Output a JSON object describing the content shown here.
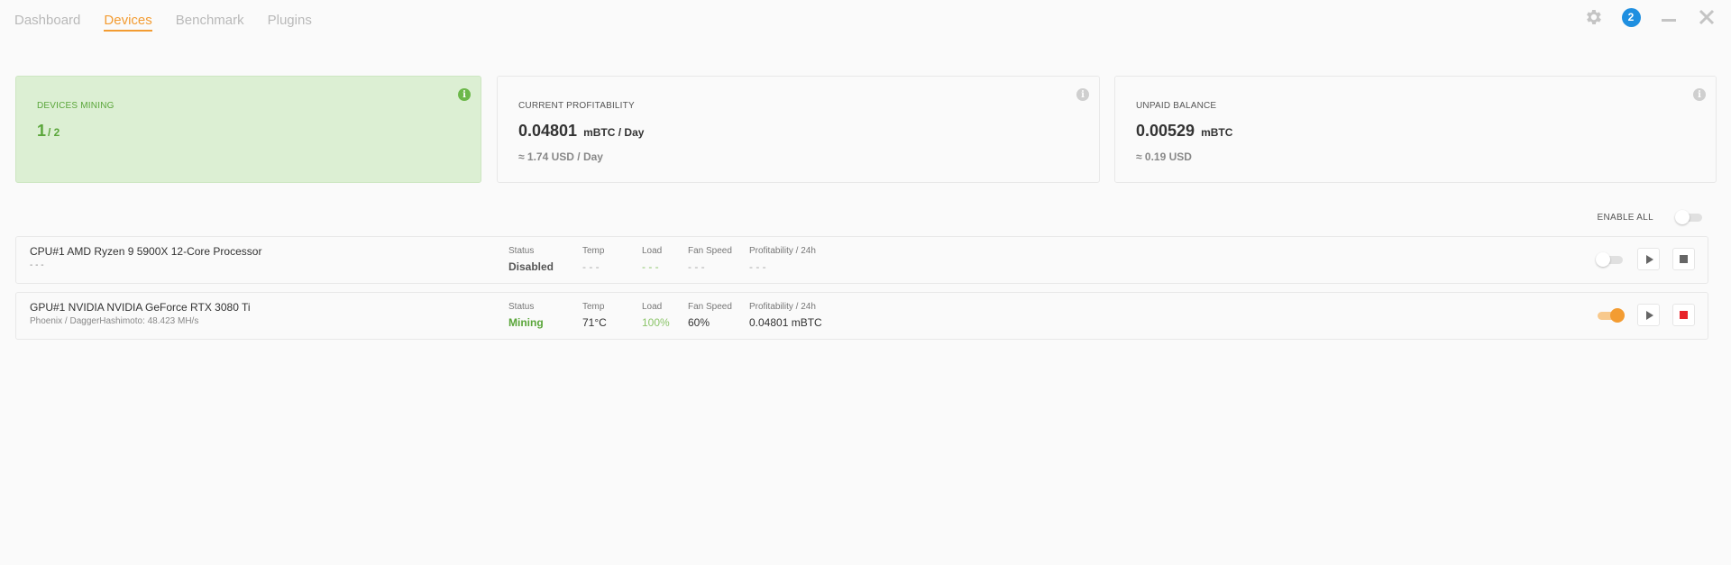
{
  "nav": {
    "tabs": [
      {
        "label": "Dashboard",
        "active": false
      },
      {
        "label": "Devices",
        "active": true
      },
      {
        "label": "Benchmark",
        "active": false
      },
      {
        "label": "Plugins",
        "active": false
      }
    ]
  },
  "topbar": {
    "notification_count": "2",
    "icons": [
      "gear-icon",
      "notification-badge",
      "minimize-icon",
      "close-icon"
    ]
  },
  "cards": {
    "devices_mining": {
      "label": "DEVICES MINING",
      "active": "1",
      "total": "/ 2"
    },
    "profitability": {
      "label": "CURRENT PROFITABILITY",
      "value": "0.04801",
      "unit": "mBTC / Day",
      "sub": "≈ 1.74 USD / Day"
    },
    "balance": {
      "label": "UNPAID BALANCE",
      "value": "0.00529",
      "unit": "mBTC",
      "sub": "≈ 0.19 USD"
    }
  },
  "enable_all": {
    "label": "ENABLE ALL",
    "on": false
  },
  "stat_labels": {
    "status": "Status",
    "temp": "Temp",
    "load": "Load",
    "fan": "Fan Speed",
    "profit": "Profitability / 24h"
  },
  "devices": [
    {
      "name": "CPU#1 AMD Ryzen 9 5900X 12-Core Processor",
      "sub": "- - -",
      "status": "Disabled",
      "temp": "- - -",
      "load": "- - -",
      "fan": "- - -",
      "profit": "- - -",
      "enabled": false
    },
    {
      "name": "GPU#1 NVIDIA NVIDIA GeForce RTX 3080 Ti",
      "sub": "Phoenix / DaggerHashimoto: 48.423 MH/s",
      "status": "Mining",
      "temp": "71°C",
      "load": "100%",
      "fan": "60%",
      "profit": "0.04801 mBTC",
      "enabled": true
    }
  ],
  "colors": {
    "accent": "#f39c32",
    "mining_green": "#5aa63a",
    "badge_blue": "#1f8fe0",
    "stop_red": "#e8242a"
  }
}
